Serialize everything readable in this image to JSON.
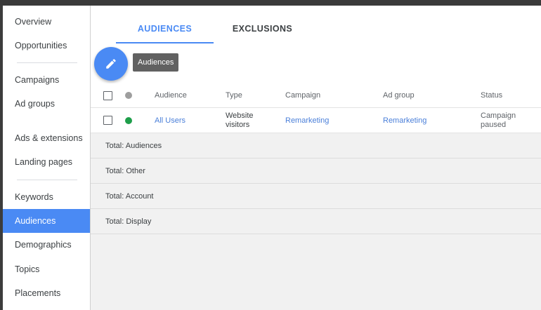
{
  "sidebar": {
    "items": [
      {
        "label": "Overview",
        "active": false
      },
      {
        "label": "Opportunities",
        "active": false
      },
      {
        "label": "Campaigns",
        "active": false
      },
      {
        "label": "Ad groups",
        "active": false
      },
      {
        "label": "Ads & extensions",
        "active": false
      },
      {
        "label": "Landing pages",
        "active": false
      },
      {
        "label": "Keywords",
        "active": false
      },
      {
        "label": "Audiences",
        "active": true
      },
      {
        "label": "Demographics",
        "active": false
      },
      {
        "label": "Topics",
        "active": false
      },
      {
        "label": "Placements",
        "active": false
      }
    ]
  },
  "tabs": [
    {
      "label": "AUDIENCES",
      "active": true
    },
    {
      "label": "EXCLUSIONS",
      "active": false
    }
  ],
  "fab": {
    "icon": "pencil-icon",
    "tooltip": "Audiences"
  },
  "table": {
    "headers": {
      "audience": "Audience",
      "type": "Type",
      "campaign": "Campaign",
      "ad_group": "Ad group",
      "status": "Status"
    },
    "rows": [
      {
        "audience": "All Users",
        "type_line1": "Website",
        "type_line2": "visitors",
        "campaign": "Remarketing",
        "ad_group": "Remarketing",
        "status_line1": "Campaign",
        "status_line2": "paused",
        "status_color": "#1e9e4a"
      }
    ],
    "totals": [
      "Total: Audiences",
      "Total: Other",
      "Total: Account",
      "Total: Display"
    ]
  },
  "colors": {
    "accent": "#4a8af4",
    "link": "#4a7fd9",
    "status_header_dot": "#9e9e9e",
    "enabled_dot": "#1e9e4a"
  }
}
